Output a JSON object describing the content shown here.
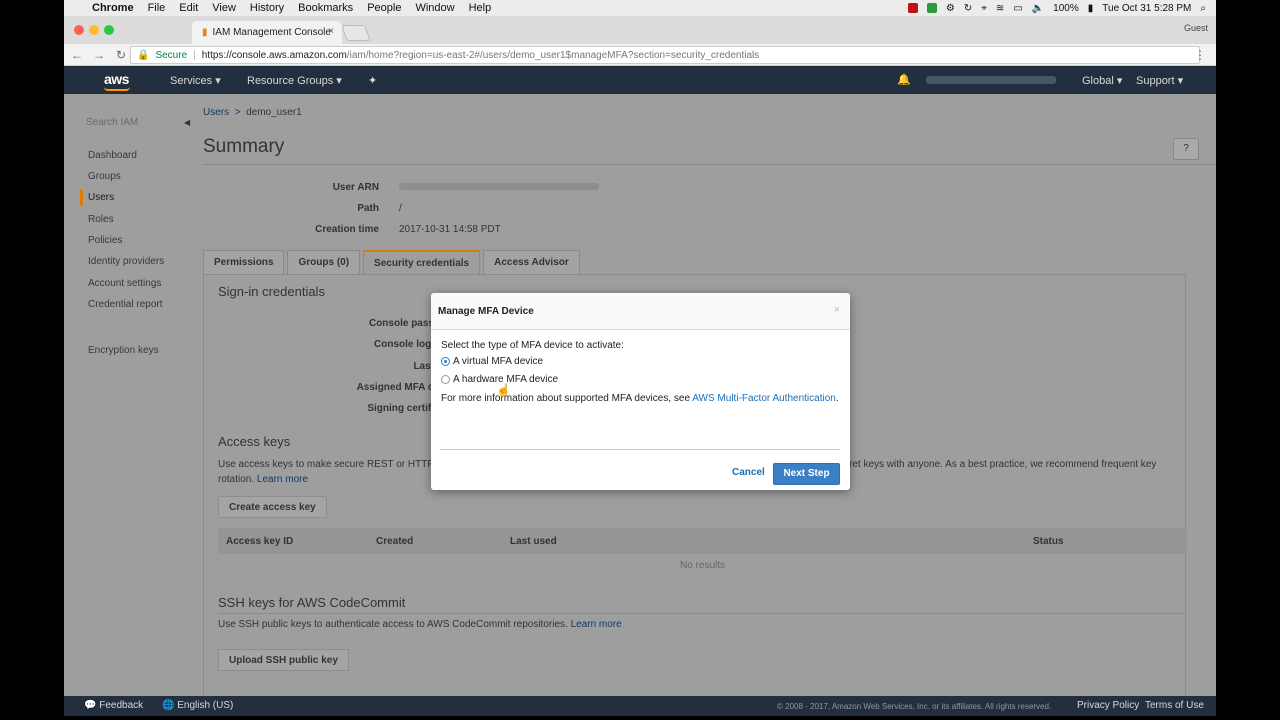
{
  "menubar": {
    "apple": "",
    "app": "Chrome",
    "items": [
      "File",
      "Edit",
      "View",
      "History",
      "Bookmarks",
      "People",
      "Window",
      "Help"
    ],
    "battery": "100%",
    "clock": "Tue Oct 31  5:28 PM"
  },
  "browser": {
    "tab_title": "IAM Management Console",
    "tab_close": "×",
    "guest": "Guest",
    "secure_label": "Secure",
    "url_domain": "https://console.aws.amazon.com",
    "url_path": "/iam/home?region=us-east-2#/users/demo_user1$manageMFA?section=security_credentials",
    "kebab": "⋮"
  },
  "awsnav": {
    "logo": "aws",
    "services": "Services",
    "resource_groups": "Resource Groups",
    "region": "Global",
    "support": "Support"
  },
  "sidebar": {
    "search_placeholder": "Search IAM",
    "items": [
      {
        "label": "Dashboard"
      },
      {
        "label": "Groups"
      },
      {
        "label": "Users"
      },
      {
        "label": "Roles"
      },
      {
        "label": "Policies"
      },
      {
        "label": "Identity providers"
      },
      {
        "label": "Account settings"
      },
      {
        "label": "Credential report"
      },
      {
        "label": "Encryption keys"
      }
    ]
  },
  "main": {
    "breadcrumb_users": "Users",
    "breadcrumb_sep": ">",
    "breadcrumb_user": "demo_user1",
    "title": "Summary",
    "help": "?",
    "user_arn_label": "User ARN",
    "path_label": "Path",
    "path_value": "/",
    "creation_label": "Creation time",
    "creation_value": "2017-10-31 14:58 PDT",
    "tabs": [
      "Permissions",
      "Groups (0)",
      "Security credentials",
      "Access Advisor"
    ],
    "signin_heading": "Sign-in credentials",
    "signin_labels": [
      "Console pass",
      "Console logi",
      "Last",
      "Assigned MFA d",
      "Signing certifi"
    ],
    "access_keys_heading": "Access keys",
    "access_keys_text_1": "Use access keys to make secure REST or HTTP C",
    "access_keys_text_1b": "ret keys with anyone. As a best practice, we recommend frequent key",
    "access_keys_text_2": "rotation.",
    "learn_more": "Learn more",
    "create_access_key": "Create access key",
    "table_headers": [
      "Access key ID",
      "Created",
      "Last used",
      "Status"
    ],
    "no_results": "No results",
    "ssh_heading": "SSH keys for AWS CodeCommit",
    "ssh_text": "Use SSH public keys to authenticate access to AWS CodeCommit repositories.",
    "upload_ssh": "Upload SSH public key"
  },
  "modal": {
    "title": "Manage MFA Device",
    "close": "×",
    "prompt": "Select the type of MFA device to activate:",
    "options": [
      {
        "label": "A virtual MFA device",
        "checked": true
      },
      {
        "label": "A hardware MFA device",
        "checked": false
      }
    ],
    "info_text": "For more information about supported MFA devices, see",
    "info_link": "AWS Multi-Factor Authentication",
    "info_end": ".",
    "cancel": "Cancel",
    "next": "Next Step"
  },
  "footer": {
    "feedback": "Feedback",
    "language": "English (US)",
    "copyright": "© 2008 - 2017, Amazon Web Services, Inc. or its affiliates. All rights reserved.",
    "privacy": "Privacy Policy",
    "terms": "Terms of Use"
  },
  "colors": {
    "aws_nav": "#232f3e",
    "aws_orange": "#ff9900",
    "primary_button": "#3b80c6",
    "link": "#1a6fb6"
  }
}
